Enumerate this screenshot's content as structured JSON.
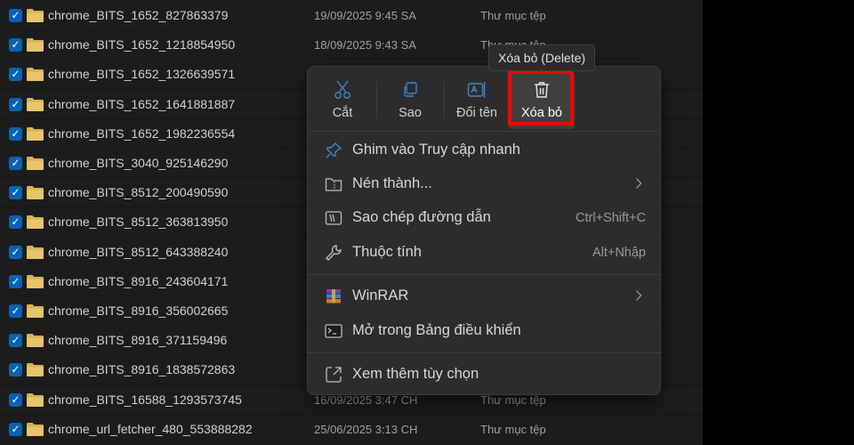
{
  "files": [
    {
      "name": "chrome_BITS_1652_827863379",
      "date": "19/09/2025 9:45 SA",
      "type": "Thư mục tệp"
    },
    {
      "name": "chrome_BITS_1652_1218854950",
      "date": "18/09/2025 9:43 SA",
      "type": "Thư mục tệp"
    },
    {
      "name": "chrome_BITS_1652_1326639571",
      "date": "",
      "type": ""
    },
    {
      "name": "chrome_BITS_1652_1641881887",
      "date": "",
      "type": ""
    },
    {
      "name": "chrome_BITS_1652_1982236554",
      "date": "",
      "type": ""
    },
    {
      "name": "chrome_BITS_3040_925146290",
      "date": "",
      "type": ""
    },
    {
      "name": "chrome_BITS_8512_200490590",
      "date": "",
      "type": ""
    },
    {
      "name": "chrome_BITS_8512_363813950",
      "date": "",
      "type": ""
    },
    {
      "name": "chrome_BITS_8512_643388240",
      "date": "",
      "type": ""
    },
    {
      "name": "chrome_BITS_8916_243604171",
      "date": "",
      "type": ""
    },
    {
      "name": "chrome_BITS_8916_356002665",
      "date": "",
      "type": ""
    },
    {
      "name": "chrome_BITS_8916_371159496",
      "date": "",
      "type": ""
    },
    {
      "name": "chrome_BITS_8916_1838572863",
      "date": "",
      "type": ""
    },
    {
      "name": "chrome_BITS_16588_1293573745",
      "date": "16/09/2025 3:47 CH",
      "type": "Thư mục tệp"
    },
    {
      "name": "chrome_url_fetcher_480_553888282",
      "date": "25/06/2025 3:13 CH",
      "type": "Thư mục tệp"
    }
  ],
  "checkbox_glyph": "✓",
  "tooltip": "Xóa bỏ (Delete)",
  "quick_actions": {
    "cut": {
      "label": "Cắt",
      "icon": "scissors-icon"
    },
    "copy": {
      "label": "Sao",
      "icon": "copy-icon"
    },
    "rename": {
      "label": "Đổi tên",
      "icon": "rename-icon"
    },
    "delete": {
      "label": "Xóa bỏ",
      "icon": "trash-icon"
    }
  },
  "menu": {
    "pin": {
      "label": "Ghim vào Truy cập nhanh",
      "icon": "pin-icon"
    },
    "compress": {
      "label": "Nén thành...",
      "icon": "zip-folder-icon"
    },
    "copy_path": {
      "label": "Sao chép đường dẫn",
      "shortcut": "Ctrl+Shift+C",
      "icon": "copy-path-icon"
    },
    "properties": {
      "label": "Thuộc tính",
      "shortcut": "Alt+Nhập",
      "icon": "wrench-icon"
    },
    "winrar": {
      "label": "WinRAR",
      "icon": "winrar-icon"
    },
    "terminal": {
      "label": "Mở trong Bảng điều khiển",
      "icon": "terminal-icon"
    },
    "more": {
      "label": "Xem thêm tùy chọn",
      "icon": "expand-icon"
    }
  },
  "colors": {
    "accent": "#0a62b3",
    "folder": "#d7b158",
    "highlight": "#ff0000",
    "menu_bg": "#2c2c2c"
  }
}
